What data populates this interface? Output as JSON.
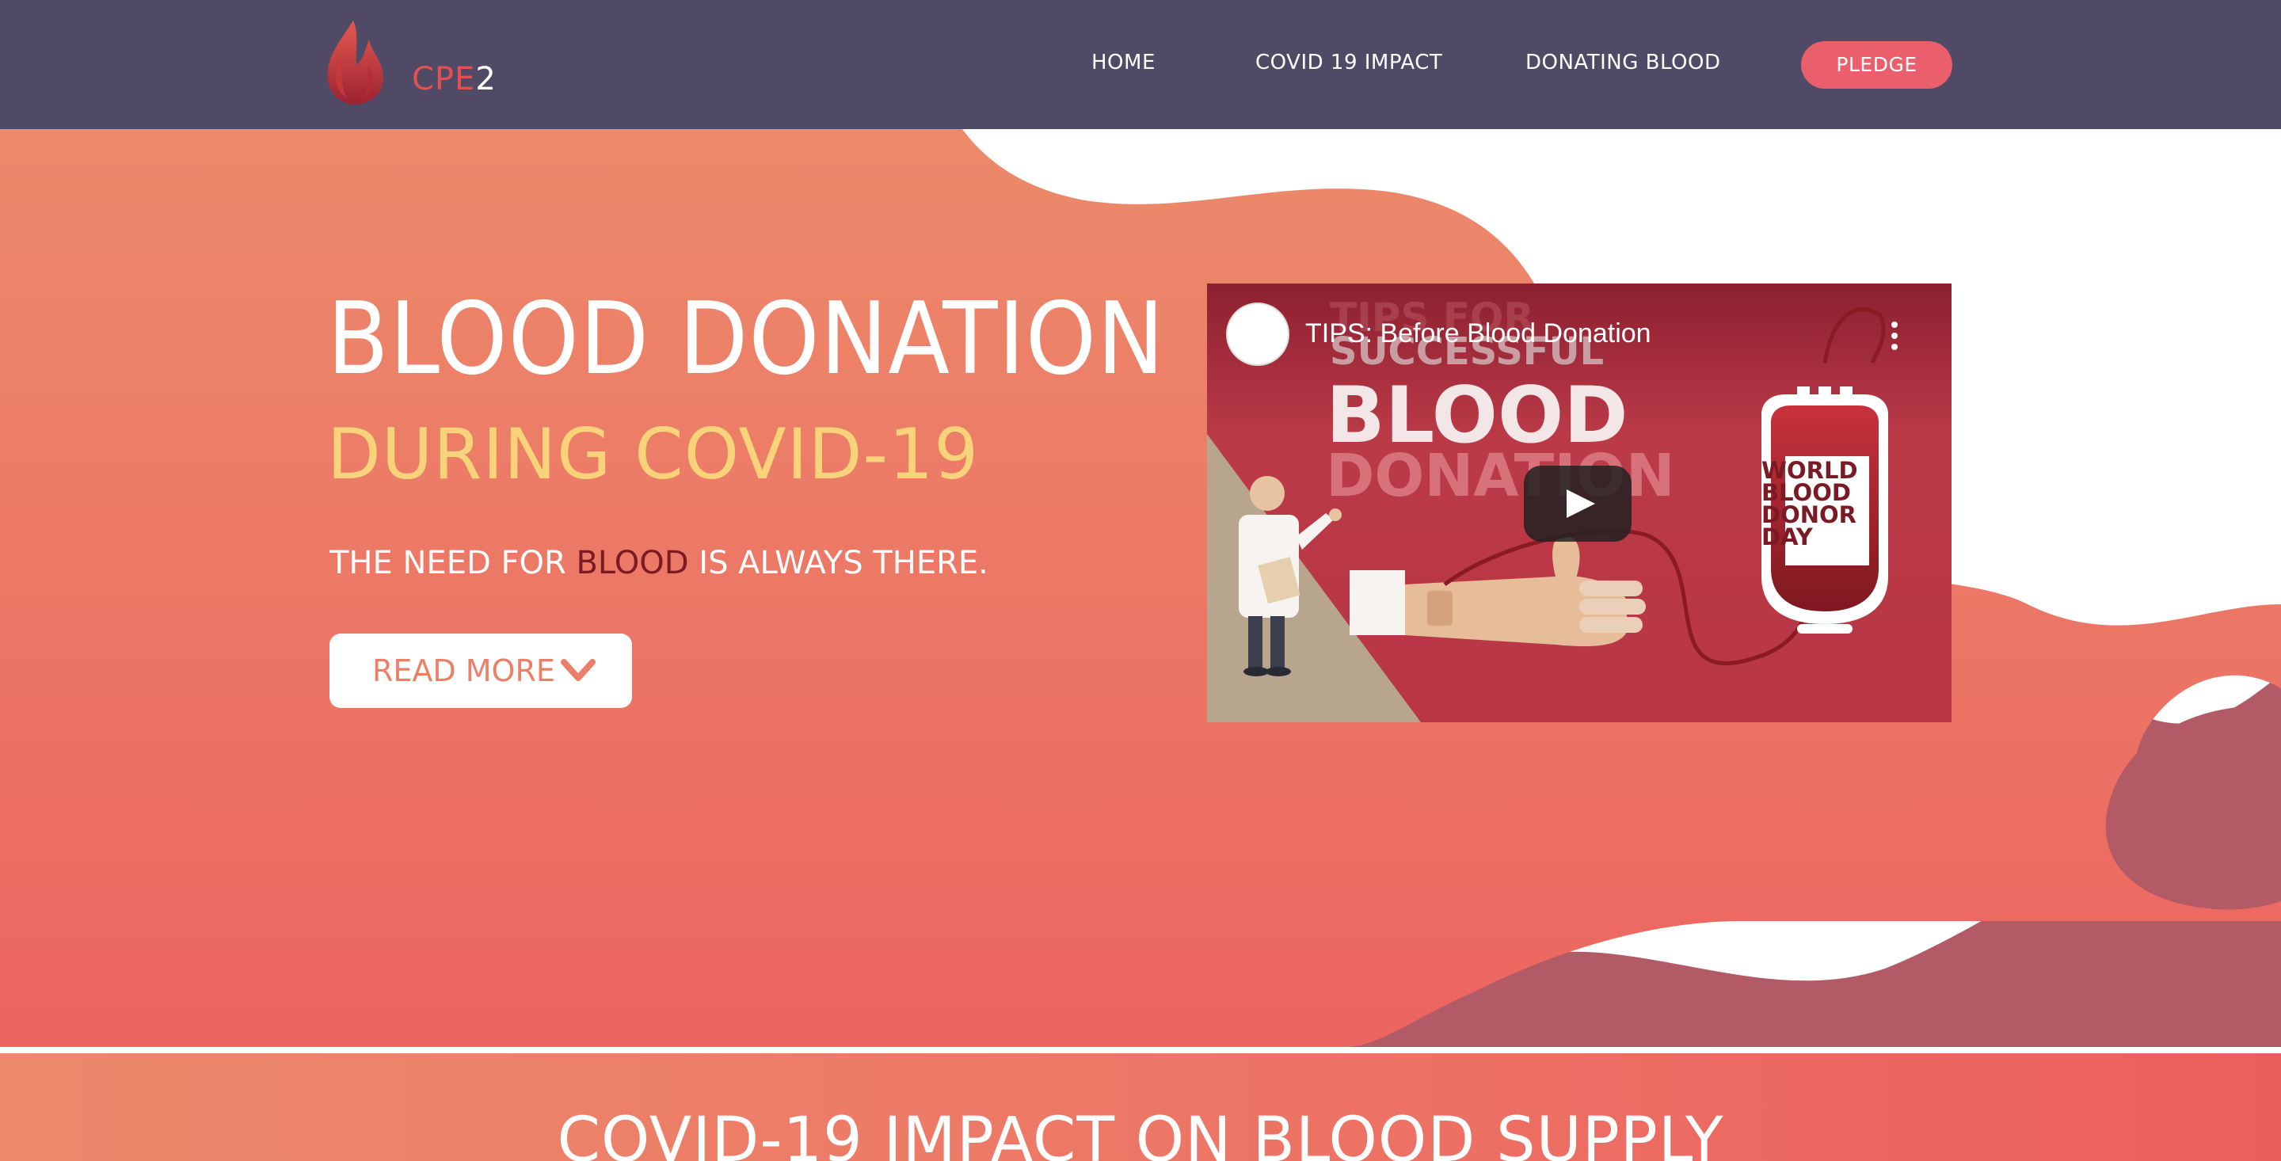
{
  "brand": {
    "name_part1": "CPE",
    "name_part2": "2"
  },
  "nav": {
    "home": "HOME",
    "covid_impact": "COVID 19 IMPACT",
    "donating_blood": "DONATING BLOOD",
    "pledge": "PLEDGE"
  },
  "hero": {
    "title": "BLOOD DONATION",
    "subtitle": "DURING COVID-19",
    "tagline_before": "THE NEED FOR ",
    "tagline_accent": "BLOOD",
    "tagline_after": " IS ALWAYS THERE.",
    "read_more": "READ MORE"
  },
  "video": {
    "title": "TIPS: Before Blood Donation",
    "thumbnail_heading_1": "TIPS FOR",
    "thumbnail_heading_2": "SUCCESSFUL",
    "thumbnail_heading_3": "BLOOD",
    "thumbnail_heading_4": "DONATION",
    "bag_label": [
      "WORLD",
      "BLOOD",
      "DONOR",
      "DAY"
    ]
  },
  "impact": {
    "title": "COVID-19 IMPACT ON BLOOD SUPPLY"
  },
  "colors": {
    "navbar": "#514a66",
    "pledge": "#ea5f6b",
    "hero_top": "#ec8a6b",
    "hero_bottom": "#ec6560",
    "subtitle": "#f8d37a",
    "accent_dark": "#7a1a22"
  }
}
